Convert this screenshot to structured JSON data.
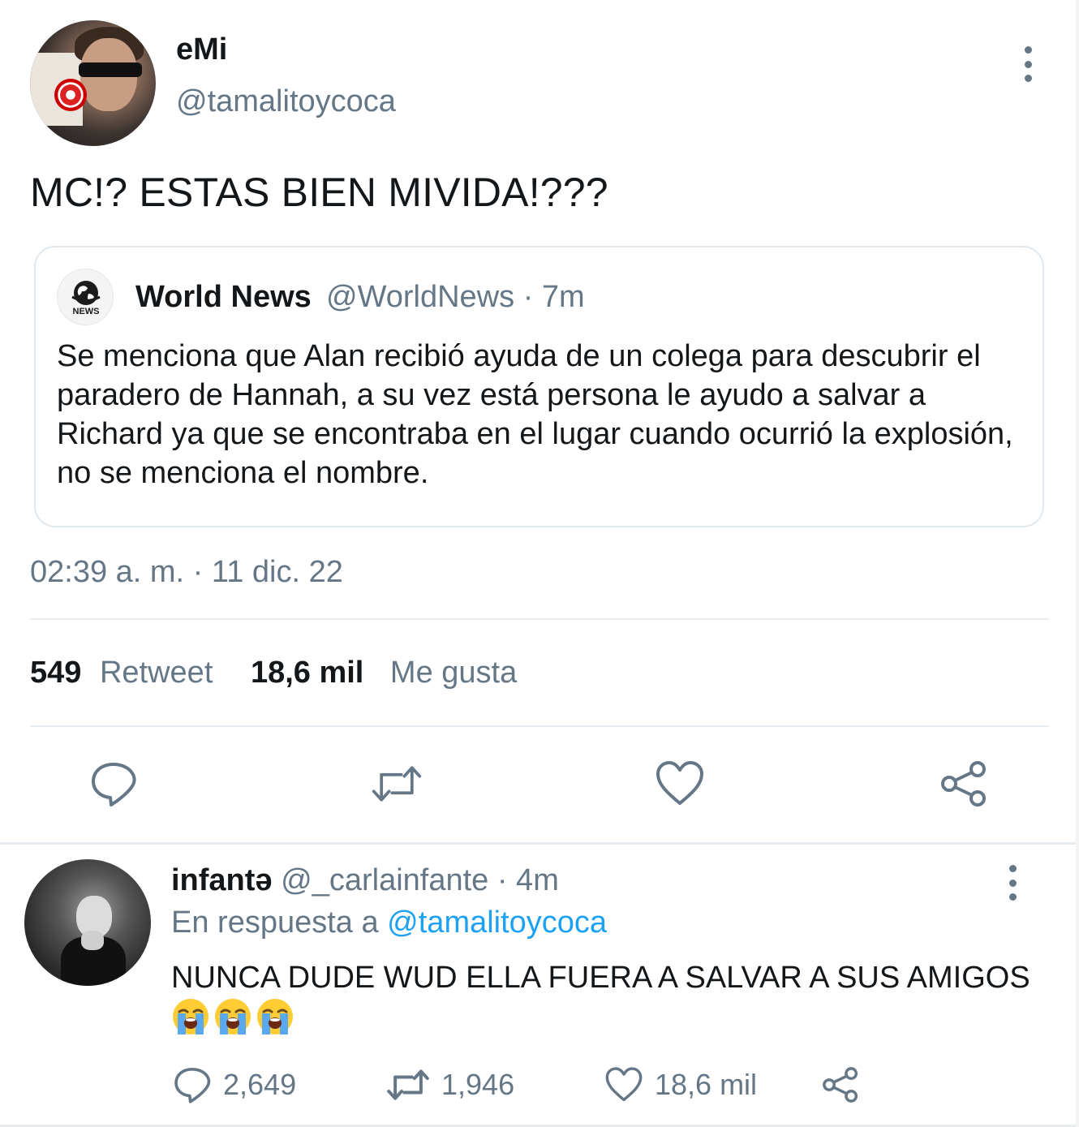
{
  "main_tweet": {
    "author_name": "eMi",
    "author_handle": "@tamalitoycoca",
    "text": "MC!? ESTAS BIEN MIVIDA!???",
    "quote": {
      "name": "World News",
      "meta": "@WorldNews · 7m",
      "avatar_label": "NEWS",
      "text": "Se menciona que Alan recibió ayuda de un colega para descubrir el paradero de Hannah, a su vez está persona le ayudo a salvar a Richard ya que se encontraba en el lugar cuando ocurrió la explosión, no se menciona el nombre."
    },
    "timestamp": "02:39 a. m. · 11 dic. 22",
    "stats": {
      "retweets_count": "549",
      "retweets_label": "Retweet",
      "likes_count": "18,6 mil",
      "likes_label": "Me gusta"
    },
    "actions": [
      "reply-icon",
      "retweet-icon",
      "like-icon",
      "share-icon"
    ]
  },
  "reply": {
    "author_name": "infantə",
    "meta": "@_carlainfante · 4m",
    "reply_to_prefix": "En respuesta a",
    "reply_to_handle": "@tamalitoycoca",
    "text": "NUNCA DUDE WUD ELLA FUERA A SALVAR A SUS AMIGOS",
    "emojis": [
      "loudly-crying-face",
      "loudly-crying-face",
      "loudly-crying-face"
    ],
    "reply_count": "2,649",
    "retweet_count": "1,946",
    "like_count": "18,6 mil"
  },
  "colors": {
    "text_primary": "#14171a",
    "text_secondary": "#657786",
    "link": "#1da1f2",
    "border": "#e1e8ed"
  }
}
